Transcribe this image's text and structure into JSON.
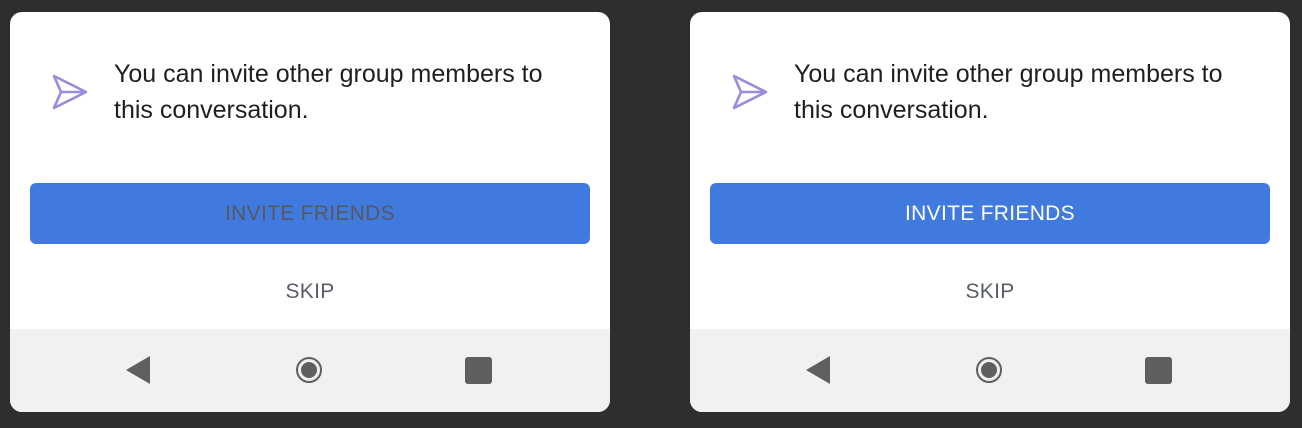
{
  "dialogs": [
    {
      "state": "disabled",
      "message": "You can invite other group members to this conversation.",
      "icon": "send-icon",
      "primary_button": {
        "label": "INVITE FRIENDS",
        "text_color": "#58585c",
        "background": "#417ade"
      },
      "secondary_button": {
        "label": "SKIP"
      },
      "nav": {
        "back_icon": "back-icon",
        "home_icon": "home-icon",
        "recents_icon": "recents-icon"
      }
    },
    {
      "state": "enabled",
      "message": "You can invite other group members to this conversation.",
      "icon": "send-icon",
      "primary_button": {
        "label": "INVITE FRIENDS",
        "text_color": "#ffffff",
        "background": "#417ade"
      },
      "secondary_button": {
        "label": "SKIP"
      },
      "nav": {
        "back_icon": "back-icon",
        "home_icon": "home-icon",
        "recents_icon": "recents-icon"
      }
    }
  ],
  "colors": {
    "backdrop": "#2e2e2e",
    "dialog_background": "#ffffff",
    "accent": "#417ade",
    "icon": "#9b8add",
    "nav_bar": "#f1f1f1"
  }
}
